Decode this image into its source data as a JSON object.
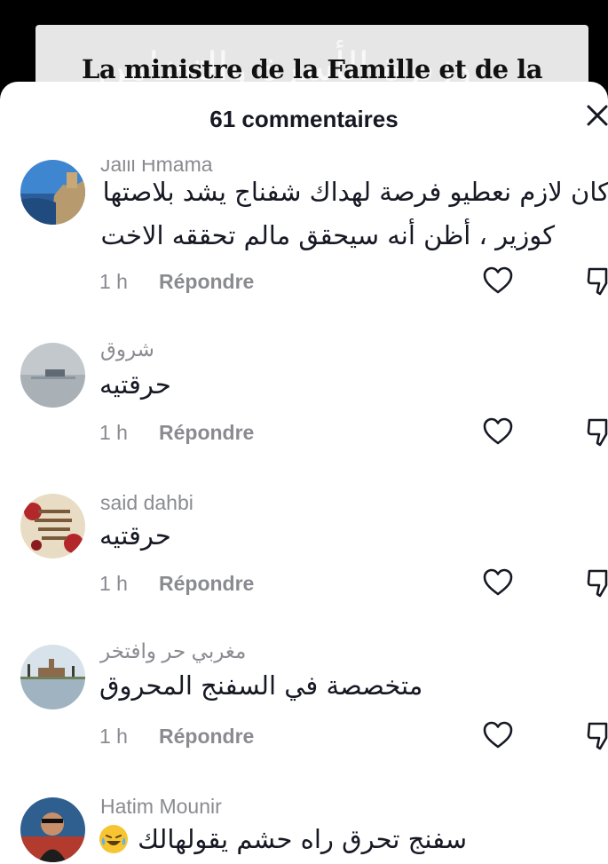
{
  "video": {
    "caption": "La ministre de la Famille et de la",
    "background_text": "وزيرة الأسرة والتضامن"
  },
  "sheet": {
    "title": "61 commentaires"
  },
  "comments": [
    {
      "username": "Jalil Hmama",
      "text_line1": "كان لازم نعطيو فرصة لهداك شفناج يشد بلاصتها",
      "text_line2": "كوزير ، أظن أنه سيحقق مالم تحققه الاخت",
      "time": "1 h",
      "reply_label": "Répondre"
    },
    {
      "username": "شروق",
      "text_line1": "حرقتيه",
      "time": "1 h",
      "reply_label": "Répondre"
    },
    {
      "username": "said dahbi",
      "text_line1": "حرقتيه",
      "time": "1 h",
      "reply_label": "Répondre"
    },
    {
      "username": "مغربي حر وافتخر",
      "text_line1": "متخصصة في السفنج المحروق",
      "time": "1 h",
      "reply_label": "Répondre"
    },
    {
      "username": "Hatim Mounir",
      "text_line1": "سفنج تحرق راه حشم يقولهالك",
      "emoji": "laughing-crying"
    }
  ],
  "avatar3_text": "اللهم اسعدنا واسعد من يحبنا وارزقنا من حيث لا نحتسب"
}
